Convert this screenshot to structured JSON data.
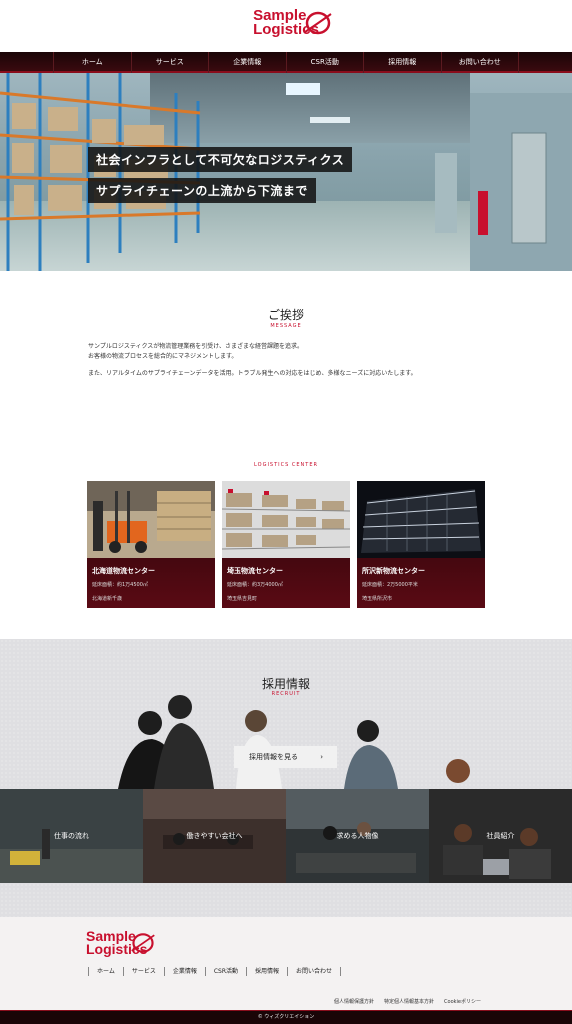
{
  "brand": {
    "line1": "Sample",
    "line2": "Logistics",
    "color": "#c8102e"
  },
  "nav": {
    "items": [
      {
        "label": "ホーム"
      },
      {
        "label": "サービス"
      },
      {
        "label": "企業情報"
      },
      {
        "label": "CSR活動"
      },
      {
        "label": "採用情報"
      },
      {
        "label": "お問い合わせ"
      }
    ]
  },
  "hero": {
    "caption1": "社会インフラとして不可欠なロジスティクス",
    "caption2": "サプライチェーンの上流から下流まで"
  },
  "greeting": {
    "title": "ご挨拶",
    "subtitle": "MESSAGE",
    "line1": "サンプルロジスティクスが物流管理業務を引受け、さまざまな経営課題を追求。",
    "line2": "お客様の物流プロセスを総合的にマネジメントします。",
    "line3": "また、リアルタイムのサプライチェーンデータを活用。トラブル発生への対応をはじめ、多様なニーズに対応いたします。"
  },
  "logistics": {
    "label": "LOGISTICS CENTER",
    "centers": [
      {
        "title": "北海道物流センター",
        "area": "延床面積：約1万4500㎡",
        "location": "北海道新千歳"
      },
      {
        "title": "埼玉物流センター",
        "area": "延床面積：約3万4000㎡",
        "location": "埼玉県吉見町"
      },
      {
        "title": "所沢新物流センター",
        "area": "延床面積：2万5000平米",
        "location": "埼玉県所沢市"
      }
    ]
  },
  "recruit": {
    "title": "採用情報",
    "subtitle": "RECRUIT",
    "button": "採用情報を見る",
    "arrow": "›",
    "tiles": [
      {
        "label": "仕事の流れ"
      },
      {
        "label": "働きやすい会社へ"
      },
      {
        "label": "求める人物像"
      },
      {
        "label": "社員紹介"
      }
    ]
  },
  "footer": {
    "nav": [
      {
        "label": "ホーム"
      },
      {
        "label": "サービス"
      },
      {
        "label": "企業情報"
      },
      {
        "label": "CSR活動"
      },
      {
        "label": "採用情報"
      },
      {
        "label": "お問い合わせ"
      }
    ],
    "links": [
      {
        "label": "個人情報保護方針"
      },
      {
        "label": "特定個人情報基本方針"
      },
      {
        "label": "Cookieポリシー"
      }
    ],
    "copyright": "© ウィズクリエイション"
  }
}
